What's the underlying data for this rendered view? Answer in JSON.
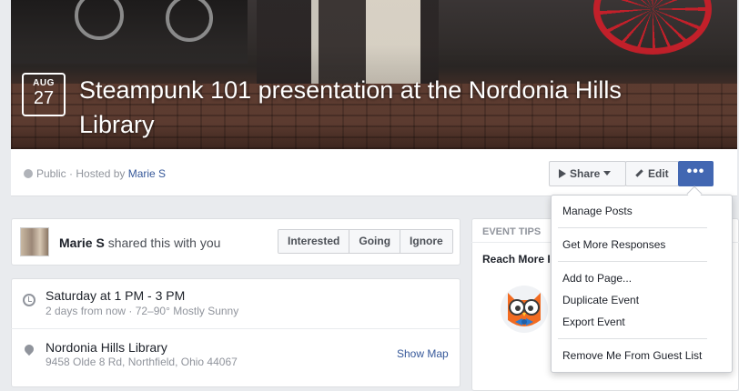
{
  "event": {
    "month": "AUG",
    "day": "27",
    "title": "Steampunk 101 presentation at the Nordonia Hills Library"
  },
  "header": {
    "privacy": "Public",
    "hosted_by": " · Hosted by ",
    "host": "Marie S",
    "share_label": "Share",
    "edit_label": "Edit",
    "more_label": "•••"
  },
  "shared": {
    "name": "Marie S",
    "text": " shared this with you",
    "buttons": [
      "Interested",
      "Going",
      "Ignore"
    ]
  },
  "details": {
    "time": "Saturday at 1 PM - 3 PM",
    "time_sub": "2 days from now · 72–90° Mostly Sunny",
    "location": "Nordonia Hills Library",
    "address": "9458 Olde 8 Rd, Northfield, Ohio 44067",
    "show_map": "Show Map"
  },
  "tips": {
    "header": "EVENT TIPS",
    "title": "Reach More People"
  },
  "menu": {
    "items": [
      "Manage Posts",
      "Get More Responses",
      "Add to Page...",
      "Duplicate Event",
      "Export Event",
      "Remove Me From Guest List"
    ]
  },
  "colors": {
    "primary": "#4267b2",
    "link": "#365899",
    "background": "#e9ebee"
  },
  "icons": [
    "globe-icon",
    "share-icon",
    "caret-icon",
    "pencil-icon",
    "clock-icon",
    "map-pin-icon",
    "owl-icon"
  ]
}
